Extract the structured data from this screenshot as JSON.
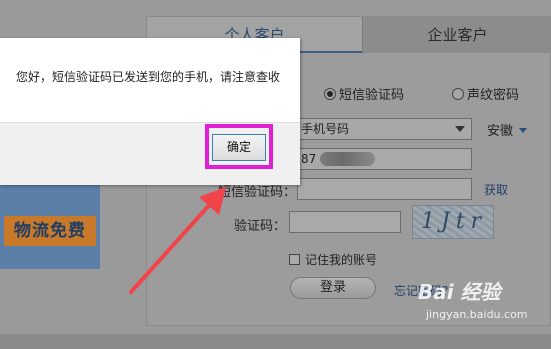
{
  "tabs": {
    "personal": "个人客户",
    "business": "企业客户"
  },
  "login": {
    "method_sms": "短信验证码",
    "method_voice": "声纹密码",
    "id_type": "手机号码",
    "province": "安徽",
    "phone_partial": "87",
    "sms_code_label": "短信验证码：",
    "get_code_link": "获取",
    "captcha_label": "验证码：",
    "captcha_text": "1Jtr",
    "remember_label": "记住我的账号",
    "login_button": "登录",
    "forgot_link": "忘记密码?"
  },
  "promo": {
    "badge": "物流免费"
  },
  "dialog": {
    "message": "您好，短信验证码已发送到您的手机，请注意查收",
    "ok_button": "确定"
  },
  "watermark": {
    "brand": "Bai 经验",
    "url": "jingyan.baidu.com"
  },
  "colors": {
    "highlight": "#e020d4",
    "arrow": "#f2424a",
    "button_border": "#3c7fb1"
  }
}
